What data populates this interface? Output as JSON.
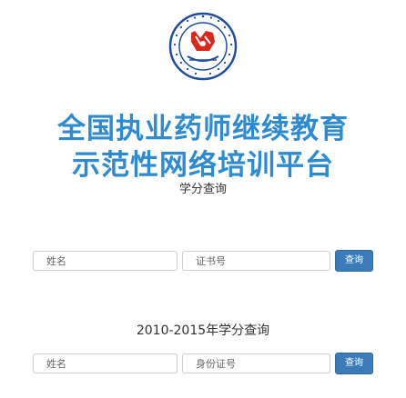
{
  "logo": {
    "icon": "pharmacist-association-seal-icon",
    "accent": "#1f4e9c",
    "red": "#d9271c"
  },
  "header": {
    "title_line1": "全国执业药师继续教育",
    "title_line2": "示范性网络培训平台",
    "title_color": "#2f8bd0"
  },
  "credit_query": {
    "label": "学分查询",
    "name_placeholder": "姓名",
    "cert_placeholder": "证书号",
    "button_label": "查询"
  },
  "legacy_query": {
    "label": "2010-2015年学分查询",
    "name_placeholder": "姓名",
    "id_placeholder": "身份证号",
    "button_label": "查询"
  }
}
